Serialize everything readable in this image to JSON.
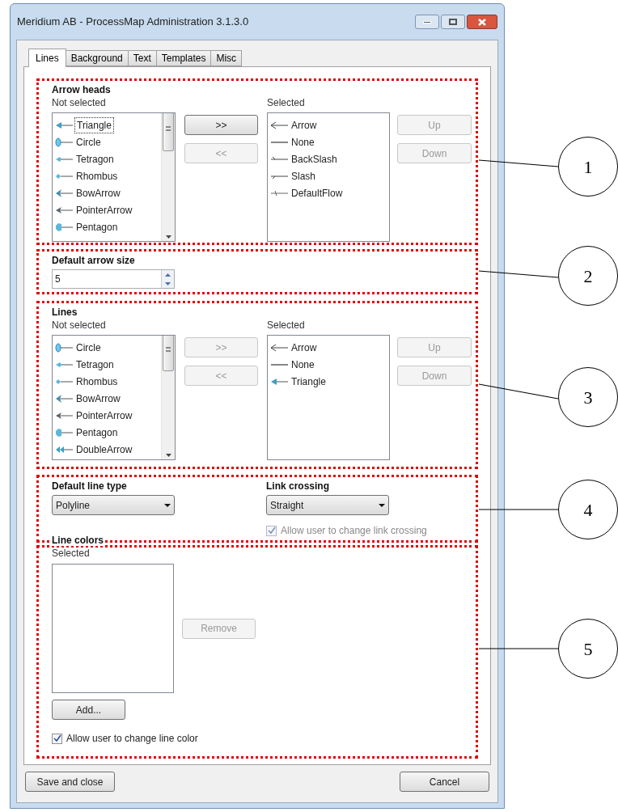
{
  "window": {
    "title": "Meridium AB - ProcessMap Administration 3.1.3.0"
  },
  "tabs": [
    {
      "label": "Lines",
      "selected": true
    },
    {
      "label": "Background",
      "selected": false
    },
    {
      "label": "Text",
      "selected": false
    },
    {
      "label": "Templates",
      "selected": false
    },
    {
      "label": "Misc",
      "selected": false
    }
  ],
  "arrow_heads": {
    "title": "Arrow heads",
    "not_selected": {
      "label": "Not selected",
      "items": [
        {
          "label": "Triangle",
          "kind": "triangle",
          "focused": true
        },
        {
          "label": "Circle",
          "kind": "circle",
          "focused": false
        },
        {
          "label": "Tetragon",
          "kind": "tetragon",
          "focused": false
        },
        {
          "label": "Rhombus",
          "kind": "rhombus",
          "focused": false
        },
        {
          "label": "BowArrow",
          "kind": "bow",
          "focused": false
        },
        {
          "label": "PointerArrow",
          "kind": "pointer",
          "focused": false
        },
        {
          "label": "Pentagon",
          "kind": "pentagon",
          "focused": false
        }
      ]
    },
    "move_buttons": [
      {
        "label": ">>",
        "disabled": false
      },
      {
        "label": "<<",
        "disabled": true
      }
    ],
    "selected": {
      "label": "Selected",
      "items": [
        {
          "label": "Arrow",
          "kind": "arrow",
          "focused": false
        },
        {
          "label": "None",
          "kind": "none",
          "focused": false
        },
        {
          "label": "BackSlash",
          "kind": "backslash",
          "focused": false
        },
        {
          "label": "Slash",
          "kind": "slash",
          "focused": false
        },
        {
          "label": "DefaultFlow",
          "kind": "defaultflow",
          "focused": false
        }
      ]
    },
    "order_buttons": [
      {
        "label": "Up",
        "disabled": true
      },
      {
        "label": "Down",
        "disabled": true
      }
    ]
  },
  "default_arrow_size": {
    "title": "Default arrow size",
    "value": "5"
  },
  "lines": {
    "title": "Lines",
    "not_selected": {
      "label": "Not selected",
      "items": [
        {
          "label": "Circle",
          "kind": "circle",
          "focused": false
        },
        {
          "label": "Tetragon",
          "kind": "tetragon",
          "focused": false
        },
        {
          "label": "Rhombus",
          "kind": "rhombus",
          "focused": false
        },
        {
          "label": "BowArrow",
          "kind": "bow",
          "focused": false
        },
        {
          "label": "PointerArrow",
          "kind": "pointer",
          "focused": false
        },
        {
          "label": "Pentagon",
          "kind": "pentagon",
          "focused": false
        },
        {
          "label": "DoubleArrow",
          "kind": "double",
          "focused": false
        }
      ]
    },
    "move_buttons": [
      {
        "label": ">>",
        "disabled": true
      },
      {
        "label": "<<",
        "disabled": true
      }
    ],
    "selected": {
      "label": "Selected",
      "items": [
        {
          "label": "Arrow",
          "kind": "arrow",
          "focused": false
        },
        {
          "label": "None",
          "kind": "none",
          "focused": false
        },
        {
          "label": "Triangle",
          "kind": "triangle",
          "focused": false
        }
      ]
    },
    "order_buttons": [
      {
        "label": "Up",
        "disabled": true
      },
      {
        "label": "Down",
        "disabled": true
      }
    ]
  },
  "line_type": {
    "title": "Default line type",
    "value": "Polyline"
  },
  "link_crossing": {
    "title": "Link crossing",
    "value": "Straight",
    "checkbox": {
      "label": "Allow user to change link crossing",
      "checked": true,
      "disabled": true
    }
  },
  "line_colors": {
    "title": "Line colors",
    "list_label": "Selected",
    "remove_button": {
      "label": "Remove",
      "disabled": true
    },
    "add_button": {
      "label": "Add...",
      "disabled": false
    },
    "checkbox": {
      "label": "Allow user to change line color",
      "checked": true,
      "disabled": false
    }
  },
  "footer_buttons": [
    {
      "label": "Save and close"
    },
    {
      "label": "Cancel"
    }
  ],
  "callouts": [
    "1",
    "2",
    "3",
    "4",
    "5"
  ]
}
